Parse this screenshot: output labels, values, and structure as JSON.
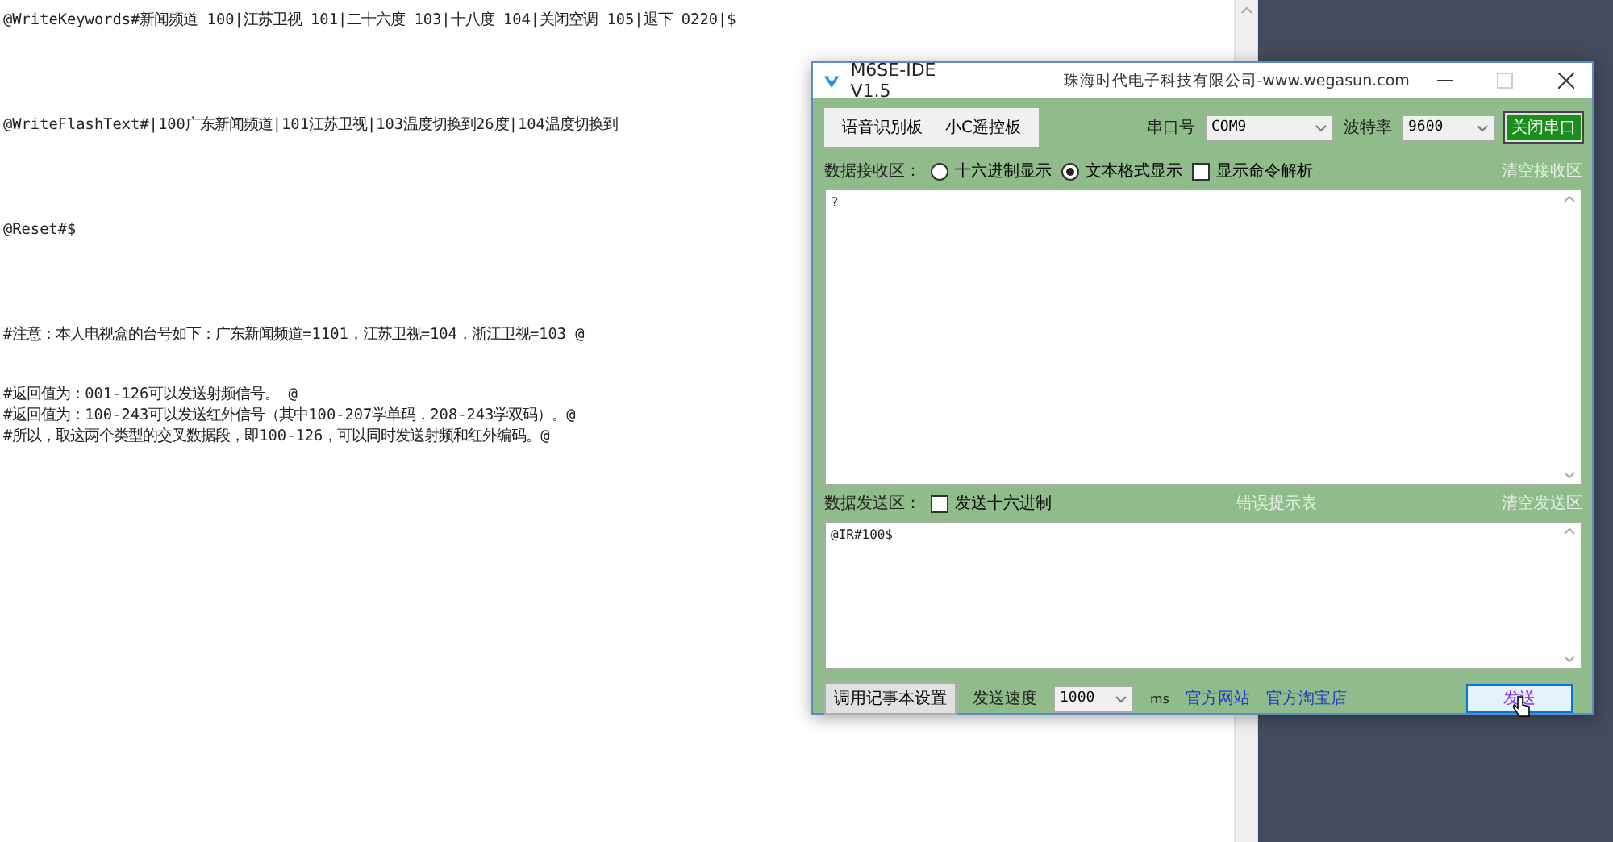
{
  "editor": {
    "groups": [
      [
        "@WriteKeywords#新闻频道 100|江苏卫视 101|二十六度 103|十八度 104|关闭空调 105|退下 0220|$"
      ],
      [
        "@WriteFlashText#|100广东新闻频道|101江苏卫视|103温度切换到26度|104温度切换到"
      ],
      [
        "@Reset#$"
      ],
      [
        "#注意：本人电视盒的台号如下：广东新闻频道=1101，江苏卫视=104，浙江卫视=103 @"
      ],
      [
        "#返回值为：001-126可以发送射频信号。 @",
        "#返回值为：100-243可以发送红外信号（其中100-207学单码，208-243学双码）。@",
        "#所以，取这两个类型的交叉数据段，即100-126，可以同时发送射频和红外编码。@"
      ]
    ]
  },
  "dialog": {
    "title": "M6SE-IDE V1.5",
    "company": "珠海时代电子科技有限公司-www.wegasun.com",
    "tabs": [
      {
        "label": "语音识别板",
        "selected": false
      },
      {
        "label": "小C遥控板",
        "selected": false
      }
    ],
    "port_label": "串口号",
    "port_value": "COM9",
    "baud_label": "波特率",
    "baud_value": "9600",
    "close_port_button": "关闭串口",
    "receive": {
      "label": "数据接收区：",
      "options": [
        {
          "label": "十六进制显示",
          "selected": false
        },
        {
          "label": "文本格式显示",
          "selected": true
        }
      ],
      "parse_checkbox": {
        "label": "显示命令解析",
        "checked": false
      },
      "clear_link": "清空接收区",
      "content": "?"
    },
    "send": {
      "label": "数据发送区：",
      "hex_checkbox": {
        "label": "发送十六进制",
        "checked": false
      },
      "error_link": "错误提示表",
      "clear_link": "清空发送区",
      "content": "@IR#100$"
    },
    "footer": {
      "notepad_button": "调用记事本设置",
      "speed_label": "发送速度",
      "speed_value": "1000",
      "unit": "ms",
      "links": [
        "官方网站",
        "官方淘宝店"
      ],
      "send_button": "发送"
    }
  }
}
